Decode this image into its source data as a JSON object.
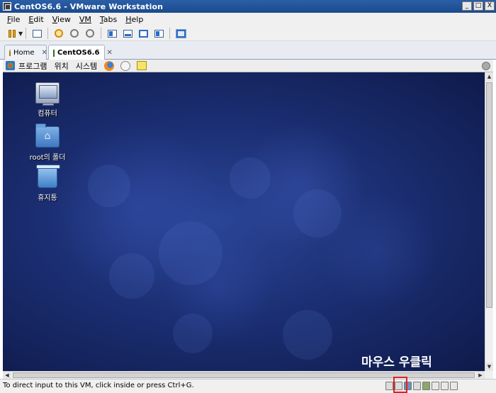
{
  "window": {
    "title": "CentOS6.6 - VMware Workstation",
    "controls": [
      "_",
      "□",
      "X"
    ]
  },
  "menubar": {
    "items": [
      {
        "label": "File",
        "accel": "F",
        "rest": "ile"
      },
      {
        "label": "Edit",
        "accel": "E",
        "rest": "dit"
      },
      {
        "label": "View",
        "accel": "V",
        "rest": "iew"
      },
      {
        "label": "VM",
        "accel": "",
        "rest": "VM"
      },
      {
        "label": "Tabs",
        "accel": "T",
        "rest": "abs"
      },
      {
        "label": "Help",
        "accel": "H",
        "rest": "elp"
      }
    ]
  },
  "toolbar": {
    "icons": [
      "pause-icon",
      "snapshot-icon",
      "revert-snapshot-icon",
      "snapshot-manager-icon",
      "sidebar-view-icon",
      "console-view-icon",
      "full-screen-icon",
      "unity-icon",
      "fit-guest-icon"
    ]
  },
  "tabs": [
    {
      "label": "Home",
      "close": "✕",
      "active": false
    },
    {
      "label": "CentOS6.6",
      "close": "✕",
      "active": true
    }
  ],
  "guest_panel": {
    "applications": "프로그램",
    "places": "위치",
    "system": "시스템"
  },
  "desktop": {
    "icons": [
      {
        "label": "컴퓨터",
        "icon": "computer-icon"
      },
      {
        "label": "root의 폴더",
        "icon": "home-folder-icon"
      },
      {
        "label": "휴지통",
        "icon": "trash-icon"
      }
    ],
    "annotation": "마우스 우클릭"
  },
  "statusbar": {
    "message": "To direct input to this VM, click inside or press Ctrl+G."
  },
  "colors": {
    "titlebar": "#1b4a8c",
    "desktop_bg": "#1c2f74",
    "highlight_box": "#e02020"
  }
}
